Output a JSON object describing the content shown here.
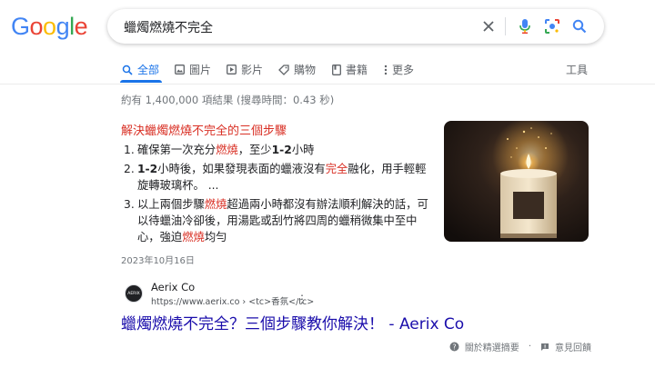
{
  "logo": [
    "G",
    "o",
    "o",
    "g",
    "l",
    "e"
  ],
  "search": {
    "query": "蠟燭燃燒不完全"
  },
  "tabs": [
    {
      "label": "全部"
    },
    {
      "label": "圖片"
    },
    {
      "label": "影片"
    },
    {
      "label": "購物"
    },
    {
      "label": "書籍"
    },
    {
      "label": "更多"
    }
  ],
  "tools_label": "工具",
  "stats": "約有 1,400,000 項結果 (搜尋時間：0.43 秒)",
  "featured": {
    "heading": "解決蠟燭燃燒不完全的三個步驟",
    "steps": [
      {
        "num": "1.",
        "parts": [
          "確保第一次充分",
          "燃燒",
          "，至少",
          "1-2",
          "小時"
        ]
      },
      {
        "num": "2.",
        "parts": [
          "1-2",
          "小時後，如果發現表面的蠟液沒有",
          "完全",
          "融化，用手輕輕旋轉玻璃杯。 ..."
        ]
      },
      {
        "num": "3.",
        "parts": [
          "以上兩個步驟",
          "燃燒",
          "超過兩小時都沒有辦法順利解決的話，可以待蠟油冷卻後，用湯匙或刮竹將四周的蠟稍微集中至中心，強迫",
          "燃燒",
          "均勻"
        ]
      }
    ],
    "date": "2023年10月16日"
  },
  "result": {
    "favicon_text": "AERIX",
    "site_name": "Aerix Co",
    "url": "https://www.aerix.co › <tc>香氛</tc>",
    "title": "蠟燭燃燒不完全？三個步驟教你解決！ - Aerix Co"
  },
  "footer": {
    "about": "關於精選摘要",
    "separator": "·",
    "feedback": "意見回饋"
  },
  "colors": {
    "link": "#1a0dab",
    "accent": "#1a73e8",
    "highlight": "#d93025"
  }
}
